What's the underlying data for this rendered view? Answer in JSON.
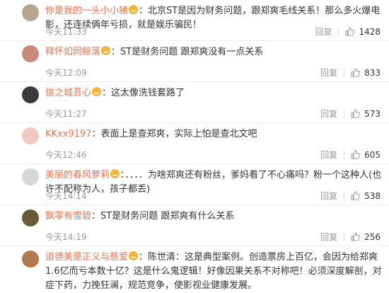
{
  "comments": [
    {
      "user": "你是我的一头小小猪",
      "text": "：北京ST是因为财务问题，跟郑爽毛线关系！那么多火爆电影，还连续俩年亏损，就是娱乐骗民！",
      "time": "今天11:33",
      "reply": "回复",
      "likes": "1428",
      "avatar_color": "#b8a590"
    },
    {
      "user": "释怀如同鲸落",
      "text": "：ST是财务问题 跟郑爽没有一点关系",
      "time": "今天12:09",
      "reply": "回复",
      "likes": "833",
      "avatar_color": "#c98a7a"
    },
    {
      "user": "信之城吾心",
      "text": "：这太像洗钱套路了",
      "time": "今天11:27",
      "reply": "回复",
      "likes": "573",
      "avatar_color": "#3a3a3a"
    },
    {
      "user": "KKxx9197",
      "text": "：表面上是查郑爽，实际上怕是查北文吧",
      "time": "今天12:46",
      "reply": "回复",
      "likes": "605",
      "avatar_color": "#f2c8c2"
    },
    {
      "user": "美丽的春风萝莉",
      "text": "：．．．．为啥郑爽还有粉丝，爹妈看了不心痛吗？粉一个这种人(也许不配称为人，孩子都丢)",
      "time": "今天14:14",
      "reply": "回复",
      "likes": "538",
      "avatar_color": "#d6d6d6"
    },
    {
      "user": "飘零有雪碧",
      "text": "：ST是财务问题 跟郑爽有什么关系",
      "time": "今天14:19",
      "reply": "回复",
      "likes": "256",
      "avatar_color": "#6b5a3a"
    },
    {
      "user": "道德美是正义与慈爱",
      "text": "：陈世清：这是典型案例。创造票房上百亿，会因为给郑爽1.6亿而亏本数十亿？这是什么鬼逻辑！好像因果关系不对称吧！必须深度解剖，对症下药，力挽狂澜，规范竞争，使影视业健康发展。",
      "time": "",
      "reply": "",
      "likes": "",
      "avatar_color": "#b07a50"
    }
  ]
}
